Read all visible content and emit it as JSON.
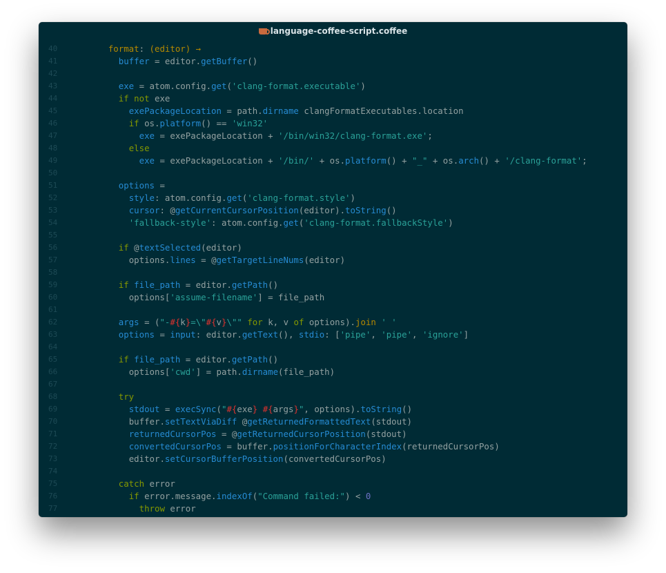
{
  "window": {
    "title": "language-coffee-script.coffee",
    "title_icon": "coffee-cup-icon"
  },
  "colors": {
    "background": "#002b35",
    "keyword": "#859900",
    "function": "#268bd2",
    "string": "#2aa198",
    "property": "#b58900",
    "interpolation": "#dc322f",
    "number": "#6c71c4",
    "text": "#93a1a1",
    "line_number": "#1d4a55"
  },
  "lines": [
    {
      "n": "40",
      "t": [
        [
          "prop",
          "format"
        ],
        [
          "txt",
          ": "
        ],
        [
          "prop",
          "(editor) →"
        ]
      ],
      "indent": 4
    },
    {
      "n": "41",
      "t": [
        [
          "var",
          "buffer"
        ],
        [
          "txt",
          " = editor."
        ],
        [
          "fn",
          "getBuffer"
        ],
        [
          "txt",
          "()"
        ]
      ],
      "indent": 6
    },
    {
      "n": "42",
      "t": [],
      "indent": 0
    },
    {
      "n": "43",
      "t": [
        [
          "var",
          "exe"
        ],
        [
          "txt",
          " = atom.config."
        ],
        [
          "fn",
          "get"
        ],
        [
          "txt",
          "("
        ],
        [
          "str",
          "'clang-format.executable'"
        ],
        [
          "txt",
          ")"
        ]
      ],
      "indent": 6
    },
    {
      "n": "44",
      "t": [
        [
          "kw",
          "if not"
        ],
        [
          "txt",
          " exe"
        ]
      ],
      "indent": 6
    },
    {
      "n": "45",
      "t": [
        [
          "var",
          "exePackageLocation"
        ],
        [
          "txt",
          " = path."
        ],
        [
          "fn",
          "dirname"
        ],
        [
          "txt",
          " clangFormatExecutables.location"
        ]
      ],
      "indent": 8
    },
    {
      "n": "46",
      "t": [
        [
          "kw",
          "if"
        ],
        [
          "txt",
          " os."
        ],
        [
          "fn",
          "platform"
        ],
        [
          "txt",
          "() == "
        ],
        [
          "str",
          "'win32'"
        ]
      ],
      "indent": 8
    },
    {
      "n": "47",
      "t": [
        [
          "var",
          "exe"
        ],
        [
          "txt",
          " = exePackageLocation + "
        ],
        [
          "str",
          "'/bin/win32/clang-format.exe'"
        ],
        [
          "txt",
          ";"
        ]
      ],
      "indent": 10
    },
    {
      "n": "48",
      "t": [
        [
          "kw",
          "else"
        ]
      ],
      "indent": 8
    },
    {
      "n": "49",
      "t": [
        [
          "var",
          "exe"
        ],
        [
          "txt",
          " = exePackageLocation + "
        ],
        [
          "str",
          "'/bin/'"
        ],
        [
          "txt",
          " + os."
        ],
        [
          "fn",
          "platform"
        ],
        [
          "txt",
          "() + "
        ],
        [
          "str",
          "\"_\""
        ],
        [
          "txt",
          " + os."
        ],
        [
          "fn",
          "arch"
        ],
        [
          "txt",
          "() + "
        ],
        [
          "str",
          "'/clang-format'"
        ],
        [
          "txt",
          ";"
        ]
      ],
      "indent": 10
    },
    {
      "n": "50",
      "t": [],
      "indent": 0
    },
    {
      "n": "51",
      "t": [
        [
          "var",
          "options"
        ],
        [
          "txt",
          " ="
        ]
      ],
      "indent": 6
    },
    {
      "n": "52",
      "t": [
        [
          "var",
          "style"
        ],
        [
          "txt",
          ": atom.config."
        ],
        [
          "fn",
          "get"
        ],
        [
          "txt",
          "("
        ],
        [
          "str",
          "'clang-format.style'"
        ],
        [
          "txt",
          ")"
        ]
      ],
      "indent": 8
    },
    {
      "n": "53",
      "t": [
        [
          "var",
          "cursor"
        ],
        [
          "txt",
          ": @"
        ],
        [
          "fn",
          "getCurrentCursorPosition"
        ],
        [
          "txt",
          "(editor)."
        ],
        [
          "fn",
          "toString"
        ],
        [
          "txt",
          "()"
        ]
      ],
      "indent": 8
    },
    {
      "n": "54",
      "t": [
        [
          "str",
          "'fallback-style'"
        ],
        [
          "txt",
          ": atom.config."
        ],
        [
          "fn",
          "get"
        ],
        [
          "txt",
          "("
        ],
        [
          "str",
          "'clang-format.fallbackStyle'"
        ],
        [
          "txt",
          ")"
        ]
      ],
      "indent": 8
    },
    {
      "n": "55",
      "t": [],
      "indent": 0
    },
    {
      "n": "56",
      "t": [
        [
          "kw",
          "if"
        ],
        [
          "txt",
          " @"
        ],
        [
          "fn",
          "textSelected"
        ],
        [
          "txt",
          "(editor)"
        ]
      ],
      "indent": 6
    },
    {
      "n": "57",
      "t": [
        [
          "txt",
          "options."
        ],
        [
          "var",
          "lines"
        ],
        [
          "txt",
          " = @"
        ],
        [
          "fn",
          "getTargetLineNums"
        ],
        [
          "txt",
          "(editor)"
        ]
      ],
      "indent": 8
    },
    {
      "n": "58",
      "t": [],
      "indent": 0
    },
    {
      "n": "59",
      "t": [
        [
          "kw",
          "if"
        ],
        [
          "txt",
          " "
        ],
        [
          "var",
          "file_path"
        ],
        [
          "txt",
          " = editor."
        ],
        [
          "fn",
          "getPath"
        ],
        [
          "txt",
          "()"
        ]
      ],
      "indent": 6
    },
    {
      "n": "60",
      "t": [
        [
          "txt",
          "options["
        ],
        [
          "str",
          "'assume-filename'"
        ],
        [
          "txt",
          "] = file_path"
        ]
      ],
      "indent": 8
    },
    {
      "n": "61",
      "t": [],
      "indent": 0
    },
    {
      "n": "62",
      "t": [
        [
          "var",
          "args"
        ],
        [
          "txt",
          " = ("
        ],
        [
          "str",
          "\"-"
        ],
        [
          "interp",
          "#{"
        ],
        [
          "txt",
          "k"
        ],
        [
          "interp",
          "}"
        ],
        [
          "str",
          "=\\\""
        ],
        [
          "interp",
          "#{"
        ],
        [
          "txt",
          "v"
        ],
        [
          "interp",
          "}"
        ],
        [
          "str",
          "\\\"\""
        ],
        [
          "txt",
          " "
        ],
        [
          "kw",
          "for"
        ],
        [
          "txt",
          " k, v "
        ],
        [
          "kw",
          "of"
        ],
        [
          "txt",
          " options)."
        ],
        [
          "prop",
          "join"
        ],
        [
          "txt",
          " "
        ],
        [
          "str",
          "' '"
        ]
      ],
      "indent": 6
    },
    {
      "n": "63",
      "t": [
        [
          "var",
          "options"
        ],
        [
          "txt",
          " = "
        ],
        [
          "var",
          "input"
        ],
        [
          "txt",
          ": editor."
        ],
        [
          "fn",
          "getText"
        ],
        [
          "txt",
          "(), "
        ],
        [
          "var",
          "stdio"
        ],
        [
          "txt",
          ": ["
        ],
        [
          "str",
          "'pipe'"
        ],
        [
          "txt",
          ", "
        ],
        [
          "str",
          "'pipe'"
        ],
        [
          "txt",
          ", "
        ],
        [
          "str",
          "'ignore'"
        ],
        [
          "txt",
          "]"
        ]
      ],
      "indent": 6
    },
    {
      "n": "64",
      "t": [],
      "indent": 0
    },
    {
      "n": "65",
      "t": [
        [
          "kw",
          "if"
        ],
        [
          "txt",
          " "
        ],
        [
          "var",
          "file_path"
        ],
        [
          "txt",
          " = editor."
        ],
        [
          "fn",
          "getPath"
        ],
        [
          "txt",
          "()"
        ]
      ],
      "indent": 6
    },
    {
      "n": "66",
      "t": [
        [
          "txt",
          "options["
        ],
        [
          "str",
          "'cwd'"
        ],
        [
          "txt",
          "] = path."
        ],
        [
          "fn",
          "dirname"
        ],
        [
          "txt",
          "(file_path)"
        ]
      ],
      "indent": 8
    },
    {
      "n": "67",
      "t": [],
      "indent": 0
    },
    {
      "n": "68",
      "t": [
        [
          "kw",
          "try"
        ]
      ],
      "indent": 6
    },
    {
      "n": "69",
      "t": [
        [
          "var",
          "stdout"
        ],
        [
          "txt",
          " = "
        ],
        [
          "fn",
          "execSync"
        ],
        [
          "txt",
          "("
        ],
        [
          "str",
          "\""
        ],
        [
          "interp",
          "#{"
        ],
        [
          "txt",
          "exe"
        ],
        [
          "interp",
          "}"
        ],
        [
          "str",
          " "
        ],
        [
          "interp",
          "#{"
        ],
        [
          "txt",
          "args"
        ],
        [
          "interp",
          "}"
        ],
        [
          "str",
          "\""
        ],
        [
          "txt",
          ", options)."
        ],
        [
          "fn",
          "toString"
        ],
        [
          "txt",
          "()"
        ]
      ],
      "indent": 8
    },
    {
      "n": "70",
      "t": [
        [
          "txt",
          "buffer."
        ],
        [
          "fn",
          "setTextViaDiff"
        ],
        [
          "txt",
          " @"
        ],
        [
          "fn",
          "getReturnedFormattedText"
        ],
        [
          "txt",
          "(stdout)"
        ]
      ],
      "indent": 8
    },
    {
      "n": "71",
      "t": [
        [
          "var",
          "returnedCursorPos"
        ],
        [
          "txt",
          " = @"
        ],
        [
          "fn",
          "getReturnedCursorPosition"
        ],
        [
          "txt",
          "(stdout)"
        ]
      ],
      "indent": 8
    },
    {
      "n": "72",
      "t": [
        [
          "var",
          "convertedCursorPos"
        ],
        [
          "txt",
          " = buffer."
        ],
        [
          "fn",
          "positionForCharacterIndex"
        ],
        [
          "txt",
          "(returnedCursorPos)"
        ]
      ],
      "indent": 8
    },
    {
      "n": "73",
      "t": [
        [
          "txt",
          "editor."
        ],
        [
          "fn",
          "setCursorBufferPosition"
        ],
        [
          "txt",
          "(convertedCursorPos)"
        ]
      ],
      "indent": 8
    },
    {
      "n": "74",
      "t": [],
      "indent": 0
    },
    {
      "n": "75",
      "t": [
        [
          "kw",
          "catch"
        ],
        [
          "txt",
          " error"
        ]
      ],
      "indent": 6
    },
    {
      "n": "76",
      "t": [
        [
          "kw",
          "if"
        ],
        [
          "txt",
          " error.message."
        ],
        [
          "fn",
          "indexOf"
        ],
        [
          "txt",
          "("
        ],
        [
          "str",
          "\"Command failed:\""
        ],
        [
          "txt",
          ") < "
        ],
        [
          "num",
          "0"
        ]
      ],
      "indent": 8
    },
    {
      "n": "77",
      "t": [
        [
          "kw",
          "throw"
        ],
        [
          "txt",
          " error"
        ]
      ],
      "indent": 10
    }
  ]
}
